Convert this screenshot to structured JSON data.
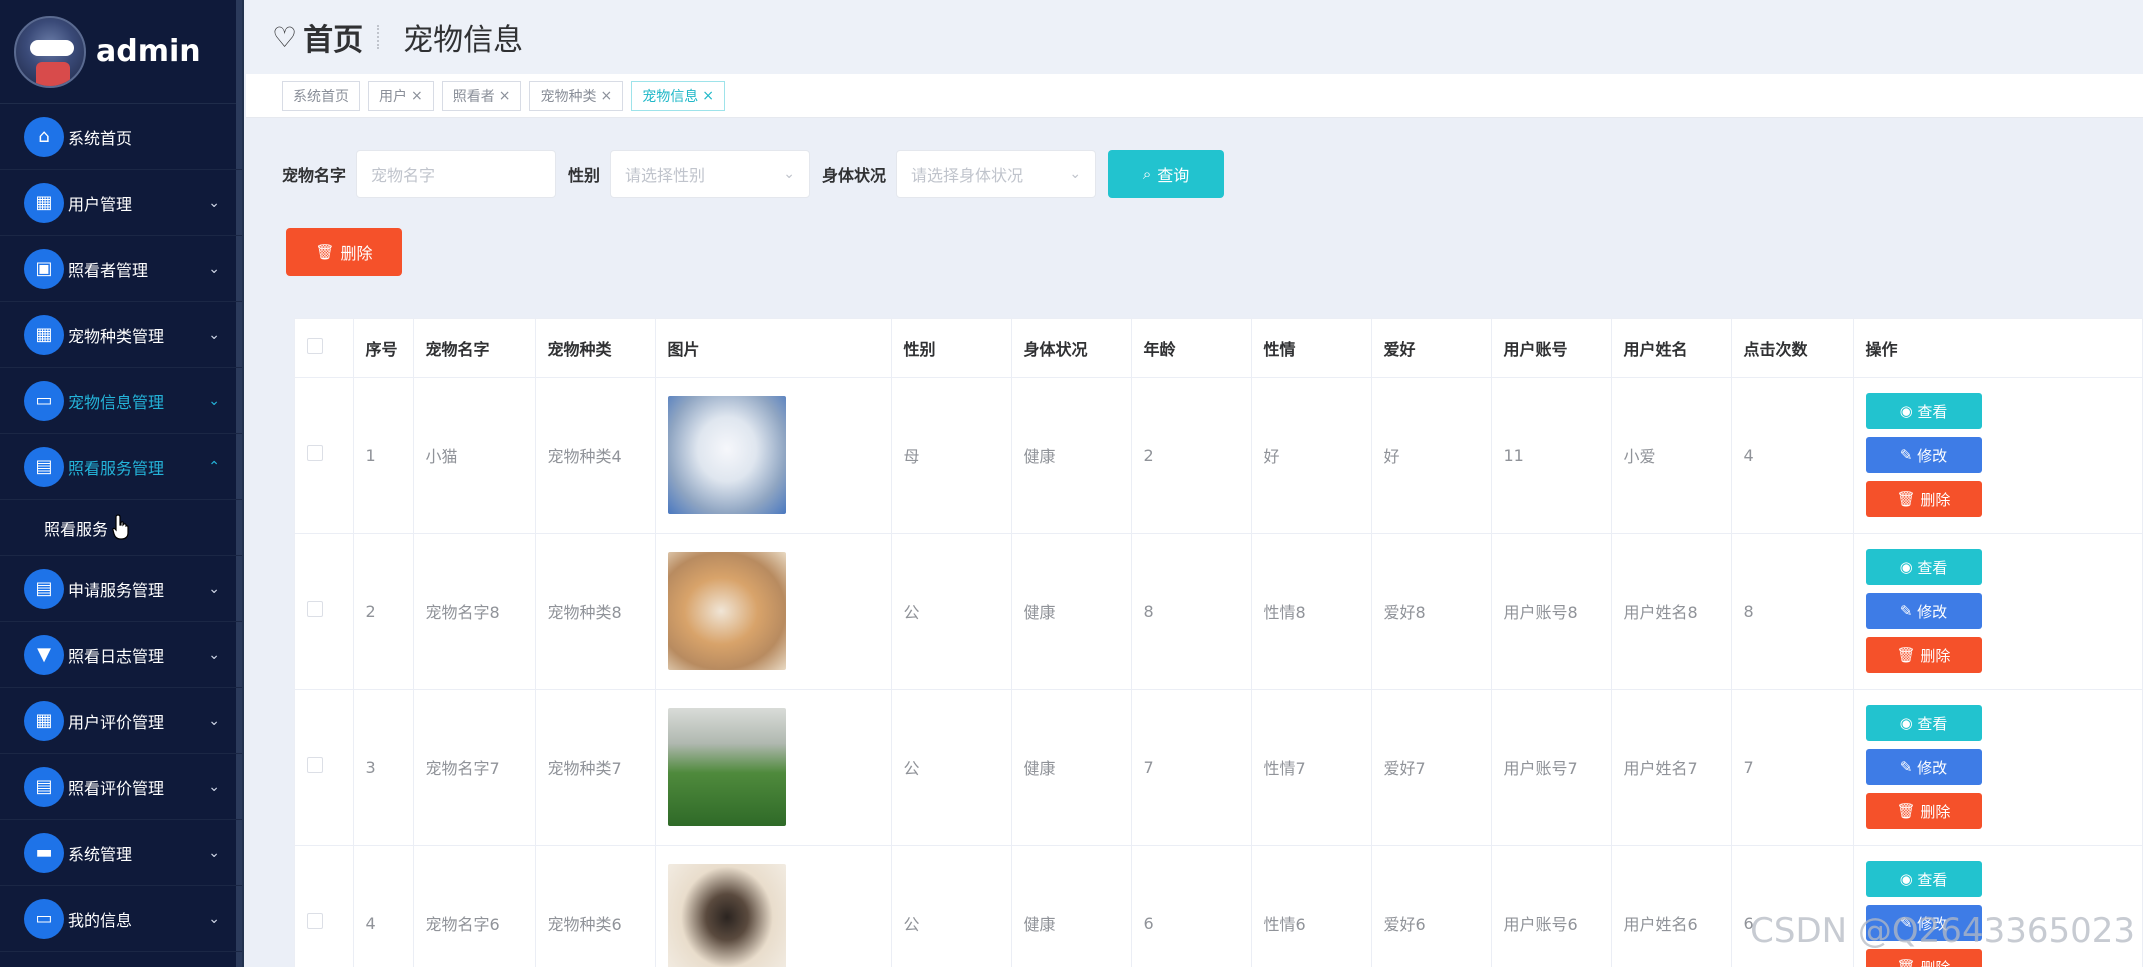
{
  "brand": {
    "name": "admin"
  },
  "sidebar": {
    "items": [
      {
        "label": "系统首页",
        "icon": "home-icon",
        "glyph": "⌂",
        "arrow": ""
      },
      {
        "label": "用户管理",
        "icon": "grid-icon",
        "glyph": "▦",
        "arrow": "⌄"
      },
      {
        "label": "照看者管理",
        "icon": "briefcase-icon",
        "glyph": "▣",
        "arrow": "⌄"
      },
      {
        "label": "宠物种类管理",
        "icon": "grid-icon",
        "glyph": "▦",
        "arrow": "⌄"
      },
      {
        "label": "宠物信息管理",
        "icon": "monitor-icon",
        "glyph": "▭",
        "arrow": "⌄"
      },
      {
        "label": "照看服务管理",
        "icon": "doc-icon",
        "glyph": "▤",
        "arrow": "⌃"
      },
      {
        "label": "申请服务管理",
        "icon": "clipboard-icon",
        "glyph": "▤",
        "arrow": "⌄"
      },
      {
        "label": "照看日志管理",
        "icon": "brush-icon",
        "glyph": "▼",
        "arrow": "⌄"
      },
      {
        "label": "用户评价管理",
        "icon": "grid-icon",
        "glyph": "▦",
        "arrow": "⌄"
      },
      {
        "label": "照看评价管理",
        "icon": "clipboard-check-icon",
        "glyph": "▤",
        "arrow": "⌄"
      },
      {
        "label": "系统管理",
        "icon": "chat-icon",
        "glyph": "▬",
        "arrow": "⌄"
      },
      {
        "label": "我的信息",
        "icon": "card-icon",
        "glyph": "▭",
        "arrow": "⌄"
      }
    ],
    "submenu": {
      "label": "照看服务"
    }
  },
  "header": {
    "heart": "♡",
    "home": "首页",
    "current": "宠物信息"
  },
  "tags": [
    {
      "label": "系统首页",
      "x": ""
    },
    {
      "label": "用户",
      "x": "×"
    },
    {
      "label": "照看者",
      "x": "×"
    },
    {
      "label": "宠物种类",
      "x": "×"
    },
    {
      "label": "宠物信息",
      "x": "×"
    }
  ],
  "search": {
    "name_label": "宠物名字",
    "name_placeholder": "宠物名字",
    "gender_label": "性别",
    "gender_placeholder": "请选择性别",
    "health_label": "身体状况",
    "health_placeholder": "请选择身体状况",
    "query_button": "查询",
    "delete_button": "删除"
  },
  "table": {
    "columns": [
      "序号",
      "宠物名字",
      "宠物种类",
      "图片",
      "性别",
      "身体状况",
      "年龄",
      "性情",
      "爱好",
      "用户账号",
      "用户姓名",
      "点击次数",
      "操作"
    ],
    "rows": [
      {
        "index": "1",
        "name": "小猫",
        "kind": "宠物种类4",
        "image": "cat",
        "gender": "母",
        "health": "健康",
        "age": "2",
        "temper": "好",
        "hobby": "好",
        "account": "11",
        "username": "小爱",
        "clicks": "4"
      },
      {
        "index": "2",
        "name": "宠物名字8",
        "kind": "宠物种类8",
        "image": "corgi",
        "gender": "公",
        "health": "健康",
        "age": "8",
        "temper": "性情8",
        "hobby": "爱好8",
        "account": "用户账号8",
        "username": "用户姓名8",
        "clicks": "8"
      },
      {
        "index": "3",
        "name": "宠物名字7",
        "kind": "宠物种类7",
        "image": "dog",
        "gender": "公",
        "health": "健康",
        "age": "7",
        "temper": "性情7",
        "hobby": "爱好7",
        "account": "用户账号7",
        "username": "用户姓名7",
        "clicks": "7"
      },
      {
        "index": "4",
        "name": "宠物名字6",
        "kind": "宠物种类6",
        "image": "pug",
        "gender": "公",
        "health": "健康",
        "age": "6",
        "temper": "性情6",
        "hobby": "爱好6",
        "account": "用户账号6",
        "username": "用户姓名6",
        "clicks": "6"
      }
    ],
    "ops": {
      "view": "查看",
      "edit": "修改",
      "delete": "删除"
    }
  },
  "watermark": "CSDN @Q2643365023",
  "colors": {
    "sidebar": "#0f1a3a",
    "accent": "#22c3cf",
    "edit": "#3e7ce6",
    "danger": "#f5512a",
    "icon_bg": "#1e73e8"
  }
}
